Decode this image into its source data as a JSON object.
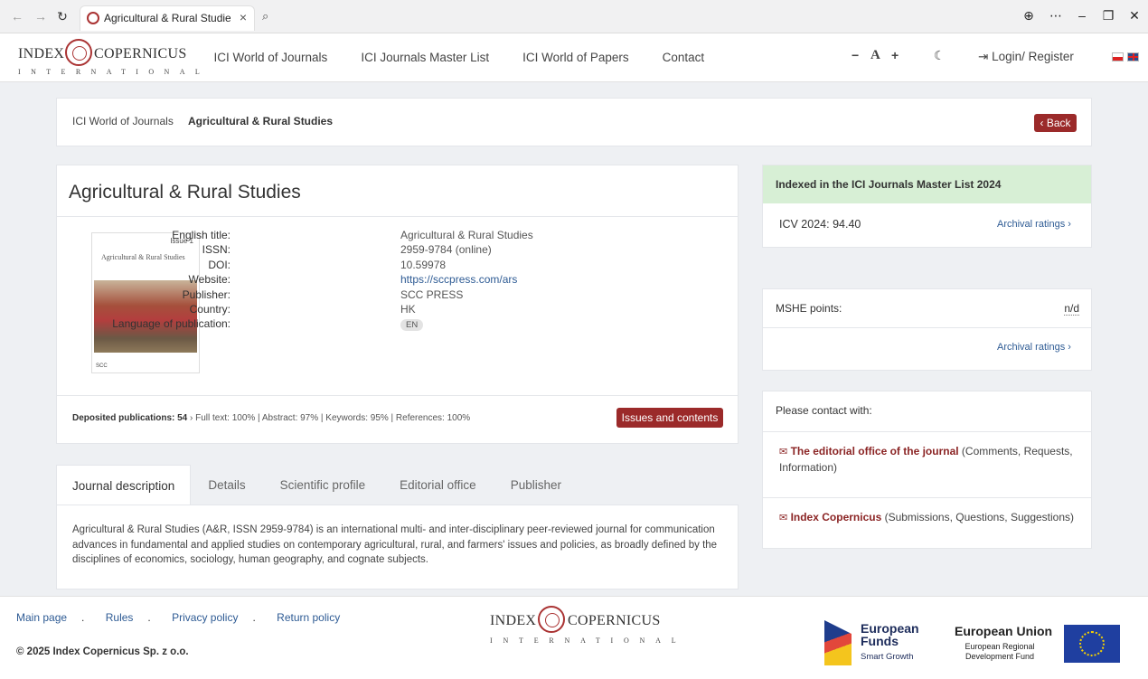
{
  "browser": {
    "tab_title": "Agricultural & Rural Studies",
    "icons": [
      "back-icon",
      "forward-icon",
      "refresh-icon",
      "close-icon",
      "search-icon",
      "globe-icon",
      "more-icon",
      "minimize-icon",
      "restore-icon"
    ]
  },
  "header": {
    "logo_left": "INDEX",
    "logo_right": "COPERNICUS",
    "logo_sub": "INTERNATIONAL",
    "nav": [
      "ICI World of Journals",
      "ICI Journals Master List",
      "ICI World of Papers",
      "Contact"
    ],
    "font_minus": "−",
    "font_label": "A",
    "font_plus": "+",
    "theme_icon": "☾",
    "login": "Login/ Register"
  },
  "breadcrumb": {
    "parent": "ICI World of Journals",
    "separator": "/",
    "current": "Agricultural & Rural Studies",
    "back_label": "Back"
  },
  "journal": {
    "title": "Agricultural & Rural Studies",
    "cover": {
      "title": "Agricultural & Rural Studies",
      "issue": "Issue 1",
      "footer": "SCC"
    },
    "meta": [
      {
        "key": "English title:",
        "value": "Agricultural & Rural Studies"
      },
      {
        "key": "ISSN:",
        "value": "2959-9784 (online)"
      },
      {
        "key": "DOI:",
        "value": "10.59978"
      },
      {
        "key": "Website:",
        "value": "https://sccpress.com/ars"
      },
      {
        "key": "Publisher:",
        "value": "SCC PRESS"
      },
      {
        "key": "Country:",
        "value": "HK"
      },
      {
        "key": "Language of publication:",
        "value": "EN"
      }
    ],
    "stats_label": "Deposited publications: 54",
    "stats_rest": "› Full text: 100% | Abstract: 97% | Keywords: 95% | References: 100%",
    "issues_button": "Issues and contents"
  },
  "tabs": [
    "Journal description",
    "Details",
    "Scientific profile",
    "Editorial office",
    "Publisher"
  ],
  "description": "Agricultural & Rural Studies (A&R, ISSN 2959-9784) is an international multi- and inter-disciplinary peer-reviewed journal for communication advances in fundamental and applied studies on contemporary agricultural, rural, and farmers' issues and policies, as broadly defined by the disciplines of economics, sociology, human geography, and cognate subjects.",
  "indexed": {
    "heading": "Indexed in the ICI Journals Master List 2024",
    "icv": "ICV 2024: 94.40",
    "archival": "Archival ratings"
  },
  "mshe": {
    "label": "MSHE points:",
    "value": "n/d",
    "archival": "Archival ratings"
  },
  "contact": {
    "heading": "Please contact with:",
    "item1_bold": "The editorial office of the journal",
    "item1_rest": " (Comments, Requests, Information)",
    "item2_bold": "Index Copernicus",
    "item2_rest": " (Submissions, Questions, Suggestions)"
  },
  "footer": {
    "links": [
      "Main page",
      "Rules",
      "Privacy policy",
      "Return policy"
    ],
    "copyright": "© 2025 Index Copernicus Sp. z o.o.",
    "eu_funds_title": "European Funds",
    "eu_funds_sub": "Smart Growth",
    "eu_union_title": "European Union",
    "eu_union_sub": "European Regional Development Fund"
  },
  "colors": {
    "accent": "#9b2a2a",
    "link": "#2e5b94",
    "indexed_bg": "#d7efd5"
  }
}
